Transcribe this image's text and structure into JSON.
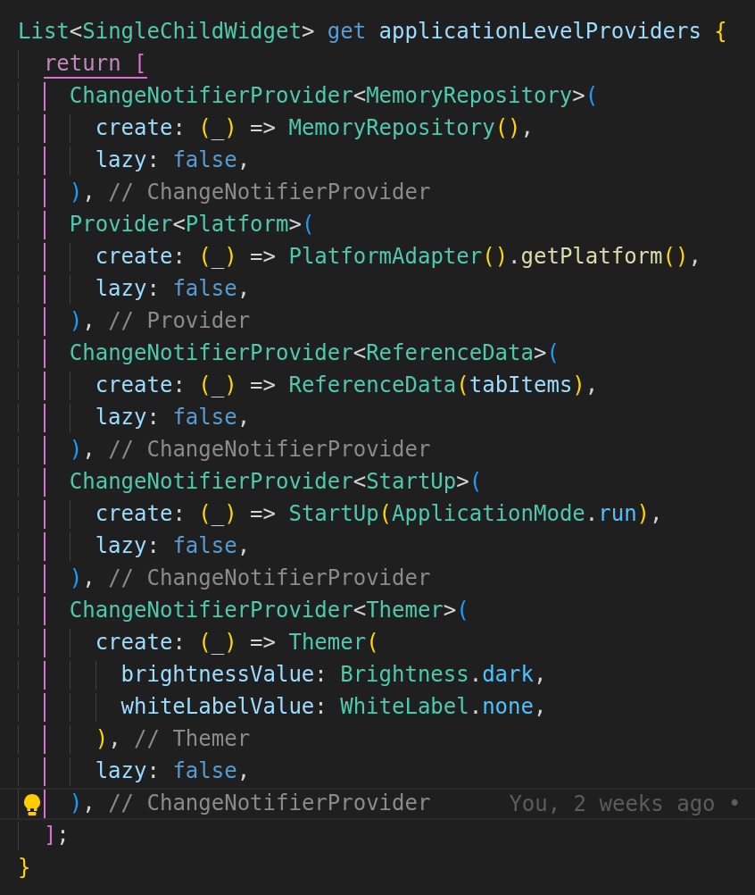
{
  "editor": {
    "lines": [
      {
        "current": false,
        "opens": false,
        "tokens": [
          {
            "kind": "type",
            "text": "List"
          },
          {
            "kind": "punct",
            "text": "<"
          },
          {
            "kind": "type",
            "text": "SingleChildWidget"
          },
          {
            "kind": "punct",
            "text": "> "
          },
          {
            "kind": "keyword",
            "text": "get"
          },
          {
            "kind": "prop",
            "text": " applicationLevelProviders"
          },
          {
            "kind": "b1",
            "text": " {"
          }
        ]
      },
      {
        "current": false,
        "opens": true,
        "tokens": [
          {
            "kind": "control",
            "text": "  return"
          },
          {
            "kind": "b2",
            "text": " ["
          }
        ]
      },
      {
        "current": false,
        "guide": true,
        "opens": false,
        "tokens": [
          {
            "kind": "type",
            "text": "    ChangeNotifierProvider"
          },
          {
            "kind": "punct",
            "text": "<"
          },
          {
            "kind": "type",
            "text": "MemoryRepository"
          },
          {
            "kind": "punct",
            "text": ">"
          },
          {
            "kind": "b3",
            "text": "("
          }
        ]
      },
      {
        "current": false,
        "guide": true,
        "opens": false,
        "tokens": [
          {
            "kind": "prop",
            "text": "      create"
          },
          {
            "kind": "punct",
            "text": ": "
          },
          {
            "kind": "b1",
            "text": "("
          },
          {
            "kind": "punct",
            "text": "_"
          },
          {
            "kind": "b1",
            "text": ")"
          },
          {
            "kind": "punct",
            "text": " => "
          },
          {
            "kind": "type",
            "text": "MemoryRepository"
          },
          {
            "kind": "b1",
            "text": "()"
          },
          {
            "kind": "punct",
            "text": ","
          }
        ]
      },
      {
        "current": false,
        "guide": true,
        "opens": false,
        "tokens": [
          {
            "kind": "prop",
            "text": "      lazy"
          },
          {
            "kind": "punct",
            "text": ": "
          },
          {
            "kind": "keyword",
            "text": "false"
          },
          {
            "kind": "punct",
            "text": ","
          }
        ]
      },
      {
        "current": false,
        "guide": true,
        "opens": false,
        "tokens": [
          {
            "kind": "b3",
            "text": "    )"
          },
          {
            "kind": "punct",
            "text": ", "
          },
          {
            "kind": "comment",
            "text": "// ChangeNotifierProvider"
          }
        ]
      },
      {
        "current": false,
        "guide": true,
        "opens": false,
        "tokens": [
          {
            "kind": "type",
            "text": "    Provider"
          },
          {
            "kind": "punct",
            "text": "<"
          },
          {
            "kind": "type",
            "text": "Platform"
          },
          {
            "kind": "punct",
            "text": ">"
          },
          {
            "kind": "b3",
            "text": "("
          }
        ]
      },
      {
        "current": false,
        "guide": true,
        "opens": false,
        "tokens": [
          {
            "kind": "prop",
            "text": "      create"
          },
          {
            "kind": "punct",
            "text": ": "
          },
          {
            "kind": "b1",
            "text": "("
          },
          {
            "kind": "punct",
            "text": "_"
          },
          {
            "kind": "b1",
            "text": ")"
          },
          {
            "kind": "punct",
            "text": " => "
          },
          {
            "kind": "type",
            "text": "PlatformAdapter"
          },
          {
            "kind": "b1",
            "text": "()"
          },
          {
            "kind": "punct",
            "text": "."
          },
          {
            "kind": "func",
            "text": "getPlatform"
          },
          {
            "kind": "b1",
            "text": "()"
          },
          {
            "kind": "punct",
            "text": ","
          }
        ]
      },
      {
        "current": false,
        "guide": true,
        "opens": false,
        "tokens": [
          {
            "kind": "prop",
            "text": "      lazy"
          },
          {
            "kind": "punct",
            "text": ": "
          },
          {
            "kind": "keyword",
            "text": "false"
          },
          {
            "kind": "punct",
            "text": ","
          }
        ]
      },
      {
        "current": false,
        "guide": true,
        "opens": false,
        "tokens": [
          {
            "kind": "b3",
            "text": "    )"
          },
          {
            "kind": "punct",
            "text": ", "
          },
          {
            "kind": "comment",
            "text": "// Provider"
          }
        ]
      },
      {
        "current": false,
        "guide": true,
        "opens": false,
        "tokens": [
          {
            "kind": "type",
            "text": "    ChangeNotifierProvider"
          },
          {
            "kind": "punct",
            "text": "<"
          },
          {
            "kind": "type",
            "text": "ReferenceData"
          },
          {
            "kind": "punct",
            "text": ">"
          },
          {
            "kind": "b3",
            "text": "("
          }
        ]
      },
      {
        "current": false,
        "guide": true,
        "opens": false,
        "tokens": [
          {
            "kind": "prop",
            "text": "      create"
          },
          {
            "kind": "punct",
            "text": ": "
          },
          {
            "kind": "b1",
            "text": "("
          },
          {
            "kind": "punct",
            "text": "_"
          },
          {
            "kind": "b1",
            "text": ")"
          },
          {
            "kind": "punct",
            "text": " => "
          },
          {
            "kind": "type",
            "text": "ReferenceData"
          },
          {
            "kind": "b1",
            "text": "("
          },
          {
            "kind": "prop",
            "text": "tabItems"
          },
          {
            "kind": "b1",
            "text": ")"
          },
          {
            "kind": "punct",
            "text": ","
          }
        ]
      },
      {
        "current": false,
        "guide": true,
        "opens": false,
        "tokens": [
          {
            "kind": "prop",
            "text": "      lazy"
          },
          {
            "kind": "punct",
            "text": ": "
          },
          {
            "kind": "keyword",
            "text": "false"
          },
          {
            "kind": "punct",
            "text": ","
          }
        ]
      },
      {
        "current": false,
        "guide": true,
        "opens": false,
        "tokens": [
          {
            "kind": "b3",
            "text": "    )"
          },
          {
            "kind": "punct",
            "text": ", "
          },
          {
            "kind": "comment",
            "text": "// ChangeNotifierProvider"
          }
        ]
      },
      {
        "current": false,
        "guide": true,
        "opens": false,
        "tokens": [
          {
            "kind": "type",
            "text": "    ChangeNotifierProvider"
          },
          {
            "kind": "punct",
            "text": "<"
          },
          {
            "kind": "type",
            "text": "StartUp"
          },
          {
            "kind": "punct",
            "text": ">"
          },
          {
            "kind": "b3",
            "text": "("
          }
        ]
      },
      {
        "current": false,
        "guide": true,
        "opens": false,
        "tokens": [
          {
            "kind": "prop",
            "text": "      create"
          },
          {
            "kind": "punct",
            "text": ": "
          },
          {
            "kind": "b1",
            "text": "("
          },
          {
            "kind": "punct",
            "text": "_"
          },
          {
            "kind": "b1",
            "text": ")"
          },
          {
            "kind": "punct",
            "text": " => "
          },
          {
            "kind": "type",
            "text": "StartUp"
          },
          {
            "kind": "b1",
            "text": "("
          },
          {
            "kind": "type",
            "text": "ApplicationMode"
          },
          {
            "kind": "punct",
            "text": "."
          },
          {
            "kind": "enum",
            "text": "run"
          },
          {
            "kind": "b1",
            "text": ")"
          },
          {
            "kind": "punct",
            "text": ","
          }
        ]
      },
      {
        "current": false,
        "guide": true,
        "opens": false,
        "tokens": [
          {
            "kind": "prop",
            "text": "      lazy"
          },
          {
            "kind": "punct",
            "text": ": "
          },
          {
            "kind": "keyword",
            "text": "false"
          },
          {
            "kind": "punct",
            "text": ","
          }
        ]
      },
      {
        "current": false,
        "guide": true,
        "opens": false,
        "tokens": [
          {
            "kind": "b3",
            "text": "    )"
          },
          {
            "kind": "punct",
            "text": ", "
          },
          {
            "kind": "comment",
            "text": "// ChangeNotifierProvider"
          }
        ]
      },
      {
        "current": false,
        "guide": true,
        "opens": false,
        "tokens": [
          {
            "kind": "type",
            "text": "    ChangeNotifierProvider"
          },
          {
            "kind": "punct",
            "text": "<"
          },
          {
            "kind": "type",
            "text": "Themer"
          },
          {
            "kind": "punct",
            "text": ">"
          },
          {
            "kind": "b3",
            "text": "("
          }
        ]
      },
      {
        "current": false,
        "guide": true,
        "opens": false,
        "tokens": [
          {
            "kind": "prop",
            "text": "      create"
          },
          {
            "kind": "punct",
            "text": ": "
          },
          {
            "kind": "b1",
            "text": "("
          },
          {
            "kind": "punct",
            "text": "_"
          },
          {
            "kind": "b1",
            "text": ")"
          },
          {
            "kind": "punct",
            "text": " => "
          },
          {
            "kind": "type",
            "text": "Themer"
          },
          {
            "kind": "b1",
            "text": "("
          }
        ]
      },
      {
        "current": false,
        "guide": true,
        "opens": false,
        "tokens": [
          {
            "kind": "prop",
            "text": "        brightnessValue"
          },
          {
            "kind": "punct",
            "text": ": "
          },
          {
            "kind": "type",
            "text": "Brightness"
          },
          {
            "kind": "punct",
            "text": "."
          },
          {
            "kind": "enum",
            "text": "dark"
          },
          {
            "kind": "punct",
            "text": ","
          }
        ]
      },
      {
        "current": false,
        "guide": true,
        "opens": false,
        "tokens": [
          {
            "kind": "prop",
            "text": "        whiteLabelValue"
          },
          {
            "kind": "punct",
            "text": ": "
          },
          {
            "kind": "type",
            "text": "WhiteLabel"
          },
          {
            "kind": "punct",
            "text": "."
          },
          {
            "kind": "enum",
            "text": "none"
          },
          {
            "kind": "punct",
            "text": ","
          }
        ]
      },
      {
        "current": false,
        "guide": true,
        "opens": false,
        "tokens": [
          {
            "kind": "b1",
            "text": "      )"
          },
          {
            "kind": "punct",
            "text": ", "
          },
          {
            "kind": "comment",
            "text": "// Themer"
          }
        ]
      },
      {
        "current": false,
        "guide": true,
        "opens": false,
        "tokens": [
          {
            "kind": "prop",
            "text": "      lazy"
          },
          {
            "kind": "punct",
            "text": ": "
          },
          {
            "kind": "keyword",
            "text": "false"
          },
          {
            "kind": "punct",
            "text": ","
          }
        ]
      },
      {
        "current": true,
        "guide": true,
        "opens": false,
        "lightbulb": true,
        "blame": "You, 2 weeks ago •",
        "tokens": [
          {
            "kind": "b3",
            "text": "    )"
          },
          {
            "kind": "punct",
            "text": ", "
          },
          {
            "kind": "comment",
            "text": "// ChangeNotifierProvider"
          }
        ]
      },
      {
        "current": false,
        "opens": false,
        "tokens": [
          {
            "kind": "b2",
            "text": "  ]"
          },
          {
            "kind": "punct",
            "text": ";"
          }
        ]
      },
      {
        "current": false,
        "opens": false,
        "tokens": [
          {
            "kind": "b1",
            "text": "}"
          }
        ]
      }
    ]
  }
}
